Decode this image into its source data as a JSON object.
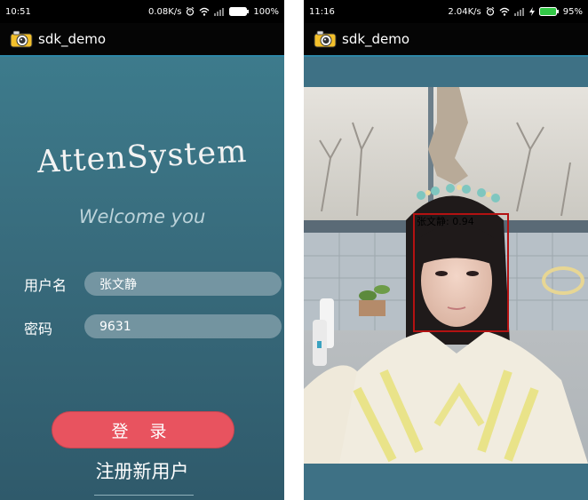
{
  "left_screen": {
    "status": {
      "time": "10:51",
      "speed": "0.08K/s",
      "battery": "100%"
    },
    "app_title": "sdk_demo",
    "brand_title": "AttenSystem",
    "welcome": "Welcome you",
    "username": {
      "label": "用户名",
      "value": "张文静"
    },
    "password": {
      "label": "密码",
      "value": "9631"
    },
    "login_button": "登 录",
    "register_link": "注册新用户"
  },
  "right_screen": {
    "status": {
      "time": "11:16",
      "speed": "2.04K/s",
      "battery": "95%"
    },
    "app_title": "sdk_demo",
    "face_label": "张文静: 0.94"
  },
  "icons": [
    "camera-app-icon",
    "alarm-icon",
    "wifi-icon",
    "signal-icon",
    "battery-icon",
    "charging-icon"
  ],
  "colors": {
    "login_button": "#e8535f",
    "face_box": "#b31212",
    "background": "#3f7082"
  }
}
